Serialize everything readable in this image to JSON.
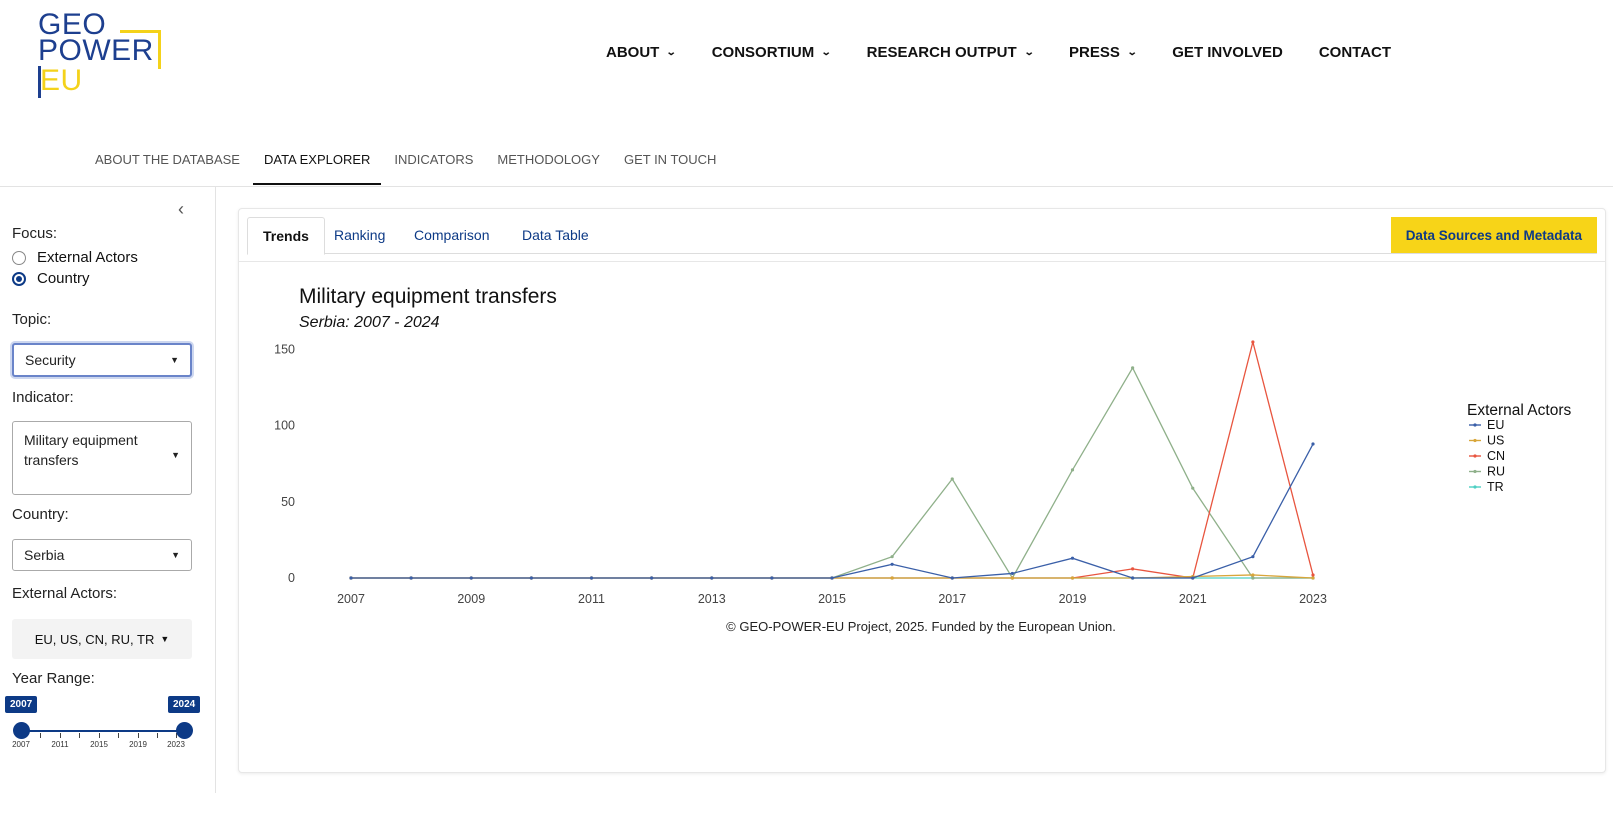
{
  "logo": {
    "line1": "GEO",
    "line2": "POWER",
    "line3": "EU"
  },
  "topnav": [
    {
      "label": "ABOUT",
      "dropdown": true
    },
    {
      "label": "CONSORTIUM",
      "dropdown": true
    },
    {
      "label": "RESEARCH OUTPUT",
      "dropdown": true
    },
    {
      "label": "PRESS",
      "dropdown": true
    },
    {
      "label": "GET INVOLVED",
      "dropdown": false
    },
    {
      "label": "CONTACT",
      "dropdown": false
    }
  ],
  "subnav": [
    {
      "label": "ABOUT THE DATABASE",
      "active": false
    },
    {
      "label": "DATA EXPLORER",
      "active": true
    },
    {
      "label": "INDICATORS",
      "active": false
    },
    {
      "label": "METHODOLOGY",
      "active": false
    },
    {
      "label": "GET IN TOUCH",
      "active": false
    }
  ],
  "sidebar": {
    "focus_label": "Focus:",
    "focus_options": [
      {
        "label": "External Actors",
        "selected": false
      },
      {
        "label": "Country",
        "selected": true
      }
    ],
    "topic_label": "Topic:",
    "topic_value": "Security",
    "indicator_label": "Indicator:",
    "indicator_value_line1": "Military equipment",
    "indicator_value_line2": "transfers",
    "country_label": "Country:",
    "country_value": "Serbia",
    "actors_label": "External Actors:",
    "actors_value": "EU, US, CN, RU, TR",
    "year_label": "Year Range:",
    "year_min": "2007",
    "year_max": "2024",
    "year_ticks": [
      "2007",
      "2011",
      "2015",
      "2019",
      "2023"
    ]
  },
  "tabs": [
    {
      "label": "Trends",
      "active": true
    },
    {
      "label": "Ranking",
      "active": false
    },
    {
      "label": "Comparison",
      "active": false
    },
    {
      "label": "Data Table",
      "active": false
    }
  ],
  "data_sources_label": "Data Sources and Metadata",
  "chart_data": {
    "type": "line",
    "title": "Military equipment transfers",
    "subtitle": "Serbia: 2007 - 2024",
    "x": [
      2007,
      2008,
      2009,
      2010,
      2011,
      2012,
      2013,
      2014,
      2015,
      2016,
      2017,
      2018,
      2019,
      2020,
      2021,
      2022,
      2023
    ],
    "x_ticks": [
      "2007",
      "2009",
      "2011",
      "2013",
      "2015",
      "2017",
      "2019",
      "2021",
      "2023"
    ],
    "y_ticks": [
      "0",
      "50",
      "100",
      "150"
    ],
    "ylim": [
      0,
      155
    ],
    "xlim": [
      2007,
      2023
    ],
    "legend_title": "External Actors",
    "legend_position": "right",
    "series": [
      {
        "name": "EU",
        "color": "#3a5fa8",
        "values": [
          0,
          0,
          0,
          0,
          0,
          0,
          0,
          0,
          0,
          9,
          0,
          3,
          13,
          0,
          0,
          14,
          88
        ]
      },
      {
        "name": "US",
        "color": "#d8a63a",
        "values": [
          0,
          0,
          0,
          0,
          0,
          0,
          0,
          0,
          0,
          0,
          0,
          0,
          0,
          0,
          1,
          2,
          0
        ]
      },
      {
        "name": "CN",
        "color": "#e8553f",
        "values": [
          0,
          0,
          0,
          0,
          0,
          0,
          0,
          0,
          0,
          0,
          0,
          0,
          0,
          6,
          0,
          155,
          2
        ]
      },
      {
        "name": "RU",
        "color": "#8fb08a",
        "values": [
          0,
          0,
          0,
          0,
          0,
          0,
          0,
          0,
          0,
          14,
          65,
          0,
          71,
          138,
          59,
          0,
          0
        ]
      },
      {
        "name": "TR",
        "color": "#4ecfc3",
        "values": [
          0,
          0,
          0,
          0,
          0,
          0,
          0,
          0,
          0,
          0,
          0,
          0,
          0,
          0,
          0,
          0,
          0
        ]
      }
    ],
    "credit": "© GEO-POWER-EU Project, 2025. Funded by the European Union."
  }
}
